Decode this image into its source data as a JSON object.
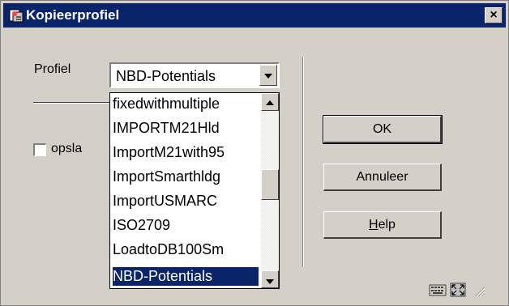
{
  "window": {
    "title": "Kopieerprofiel",
    "close_label": "×"
  },
  "form": {
    "profile_label": "Profiel",
    "profile_value": "NBD-Potentials",
    "save_checkbox_label": "opsla",
    "save_checked": false
  },
  "dropdown": {
    "items": [
      "fixedwithmultiple",
      "IMPORTM21Hld",
      "ImportM21with95",
      "ImportSmarthldg",
      "ImportUSMARC",
      "ISO2709",
      "LoadtoDB100Sm",
      "NBD-Potentials"
    ],
    "selected_index": 7
  },
  "buttons": {
    "ok": "OK",
    "cancel": "Annuleer",
    "help_first": "H",
    "help_rest": "elp"
  },
  "icons": {
    "title": "profile-copy-icon",
    "close": "close-icon",
    "keyboard": "keyboard-icon",
    "expand": "expand-icon",
    "resize": "resize-grip-icon"
  },
  "colors": {
    "titlebar": "#0a246a",
    "face": "#d4d0c8",
    "selection": "#0a246a"
  }
}
